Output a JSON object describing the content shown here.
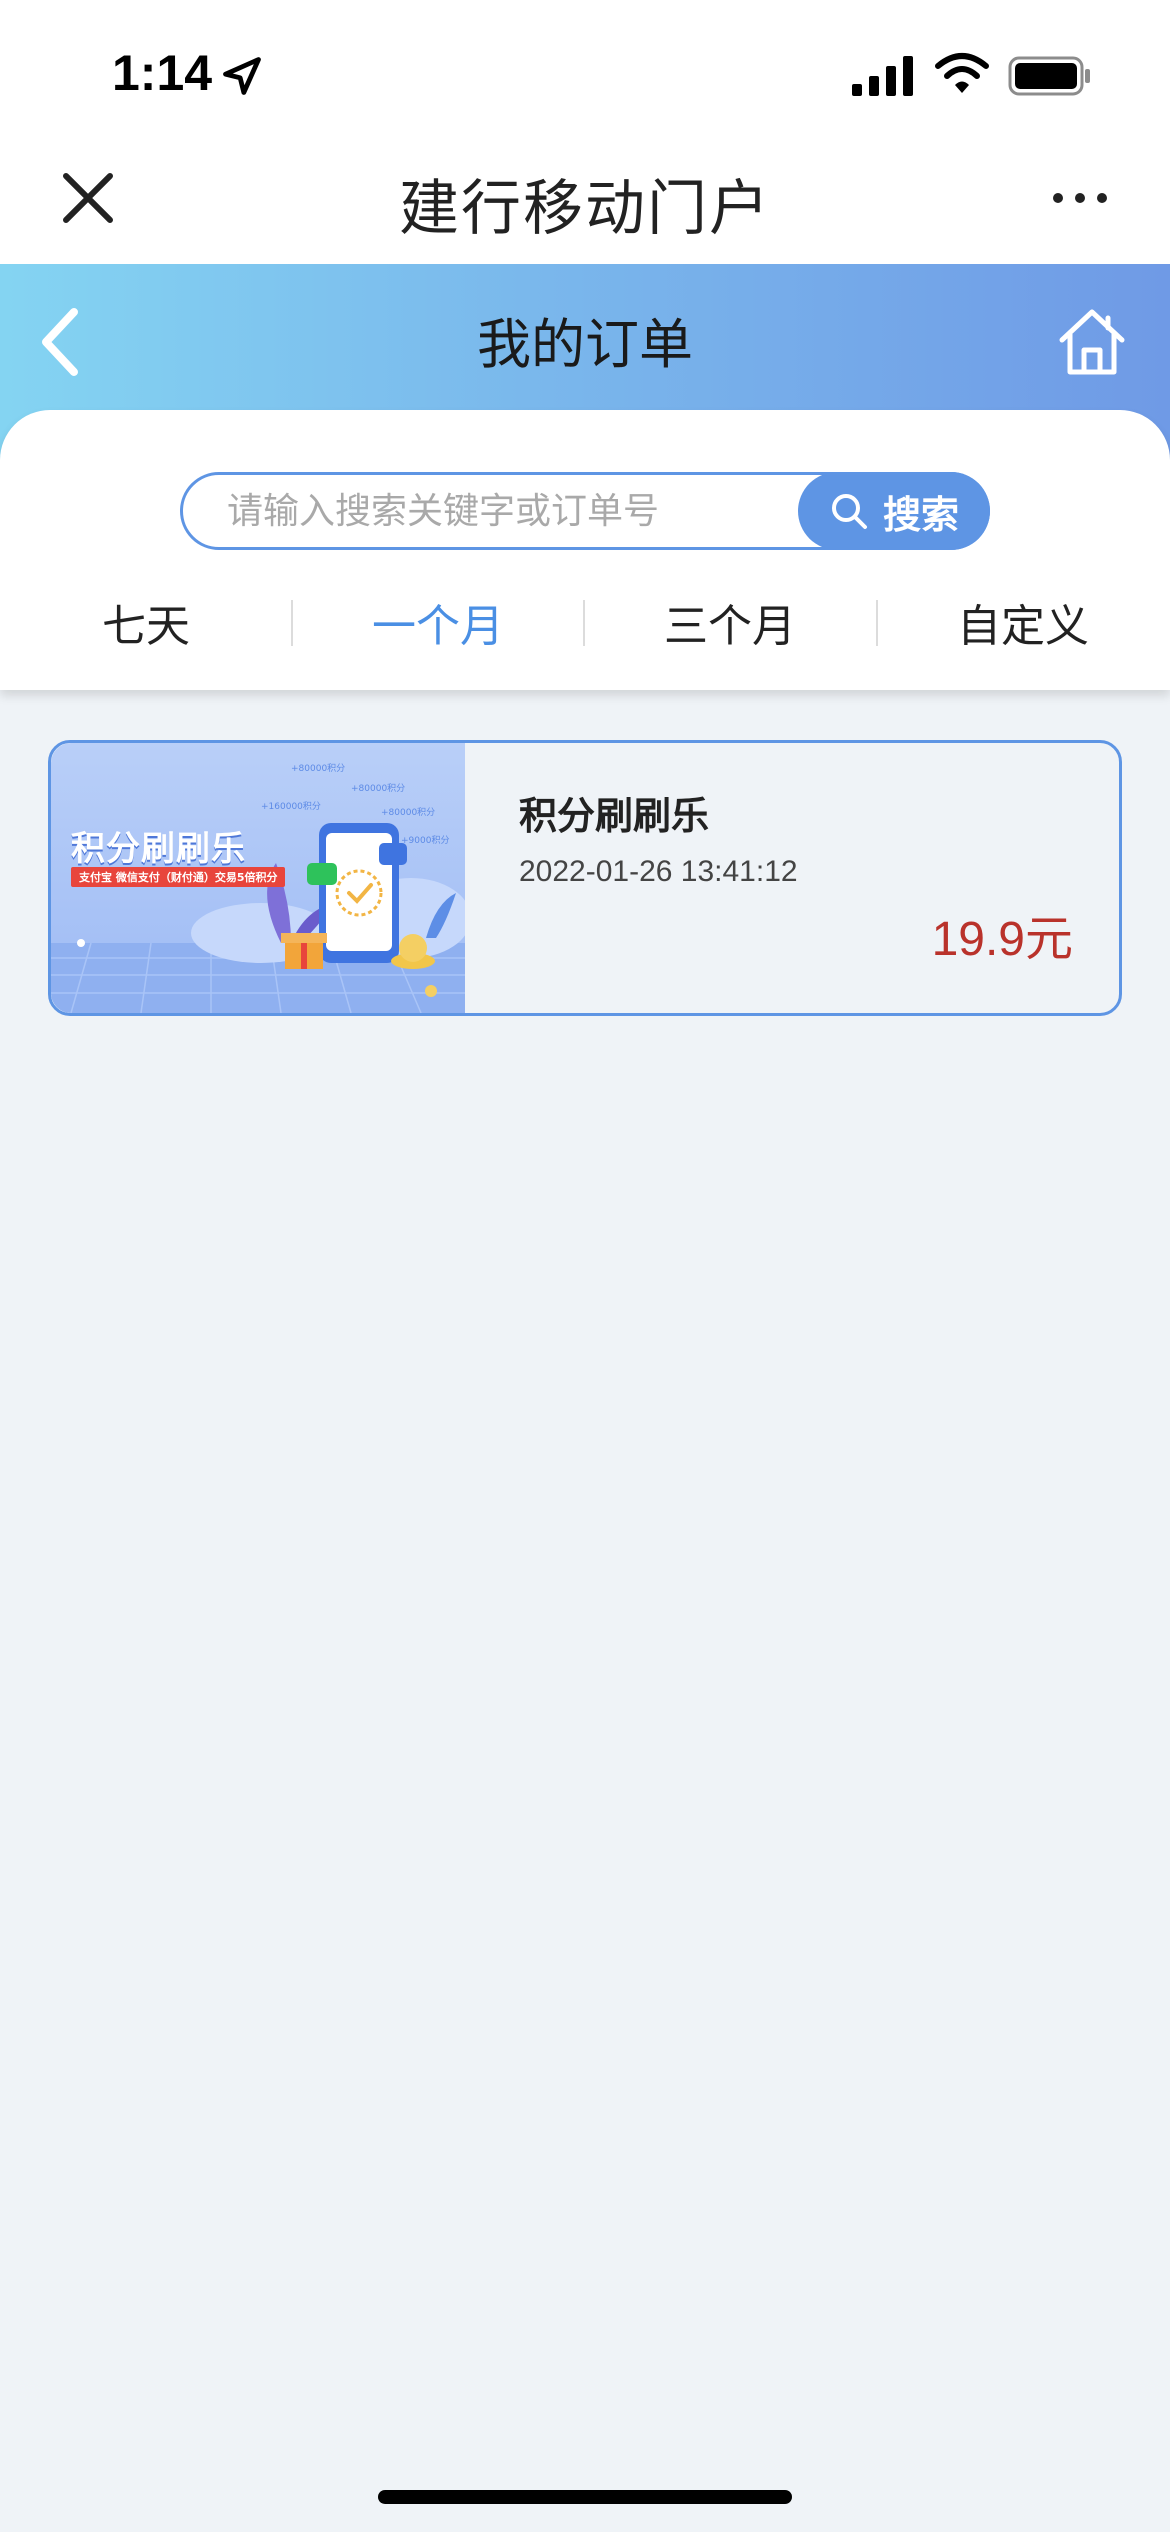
{
  "status_bar": {
    "time": "1:14"
  },
  "webview": {
    "title": "建行移动门户"
  },
  "banner": {
    "title": "我的订单"
  },
  "search": {
    "placeholder": "请输入搜索关键字或订单号",
    "button_label": "搜索"
  },
  "tabs": [
    {
      "label": "七天",
      "active": false
    },
    {
      "label": "一个月",
      "active": true
    },
    {
      "label": "三个月",
      "active": false
    },
    {
      "label": "自定义",
      "active": false
    }
  ],
  "orders": [
    {
      "image_title": "积分刷刷乐",
      "image_subtitle": "支付宝 微信支付（财付通）交易5倍积分",
      "name": "积分刷刷乐",
      "date": "2022-01-26 13:41:12",
      "price": "19.9元"
    }
  ],
  "colors": {
    "accent": "#5e95e4",
    "active_tab": "#4a8fe4",
    "price": "#b9322b",
    "background": "#eff3f7"
  }
}
